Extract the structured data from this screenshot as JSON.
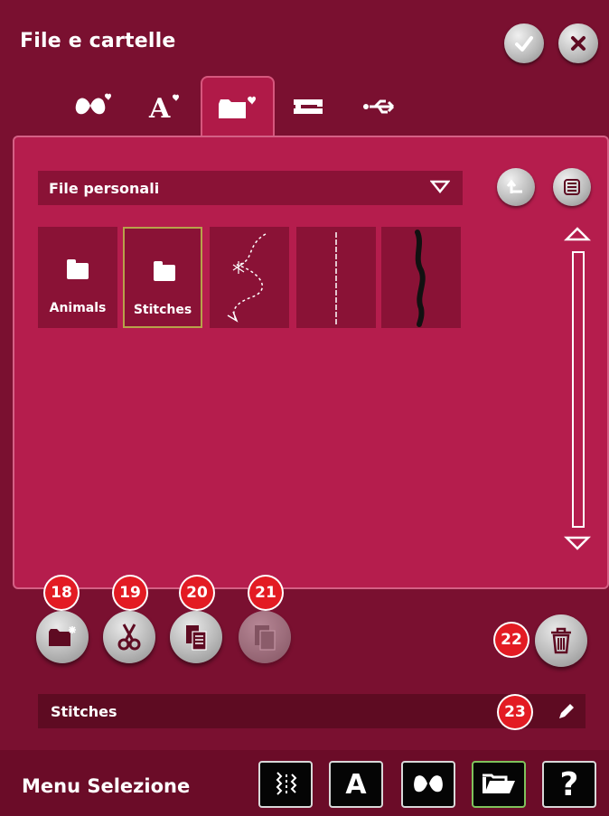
{
  "window": {
    "title": "File e cartelle"
  },
  "header_buttons": {
    "confirm_icon": "check-icon",
    "close_icon": "close-icon"
  },
  "tabs": [
    {
      "icon": "butterfly-heart-icon",
      "active": false
    },
    {
      "icon": "font-heart-icon",
      "active": false
    },
    {
      "icon": "folder-heart-icon",
      "active": true
    },
    {
      "icon": "sewing-machine-icon",
      "active": false
    },
    {
      "icon": "usb-icon",
      "active": false
    }
  ],
  "location": {
    "selected": "File personali"
  },
  "items": [
    {
      "label": "Animals",
      "type": "folder",
      "selected": false
    },
    {
      "label": "Stitches",
      "type": "folder",
      "selected": true
    },
    {
      "label": "",
      "type": "stitch-preview-decorative",
      "selected": false
    },
    {
      "label": "",
      "type": "stitch-preview-straight",
      "selected": false
    },
    {
      "label": "",
      "type": "stitch-preview-dense",
      "selected": false
    }
  ],
  "tools": {
    "new_folder": {
      "icon": "new-folder-icon",
      "badge": "18"
    },
    "cut": {
      "icon": "scissors-icon",
      "badge": "19"
    },
    "copy": {
      "icon": "copy-icon",
      "badge": "20"
    },
    "paste": {
      "icon": "paste-icon",
      "badge": "21"
    },
    "delete": {
      "icon": "trash-icon",
      "badge": "22"
    },
    "rename": {
      "icon": "pencil-icon",
      "badge": "23"
    }
  },
  "filename": {
    "value": "Stitches"
  },
  "bottom": {
    "title": "Menu Selezione",
    "nav": [
      {
        "icon": "stitch-menu-icon"
      },
      {
        "icon": "font-menu-icon",
        "label": "A"
      },
      {
        "icon": "butterfly-menu-icon"
      },
      {
        "icon": "folder-open-icon"
      },
      {
        "icon": "help-icon",
        "label": "?"
      }
    ]
  },
  "colors": {
    "background": "#7a1030",
    "panel": "#b51d4d",
    "badge": "#e31b23"
  }
}
